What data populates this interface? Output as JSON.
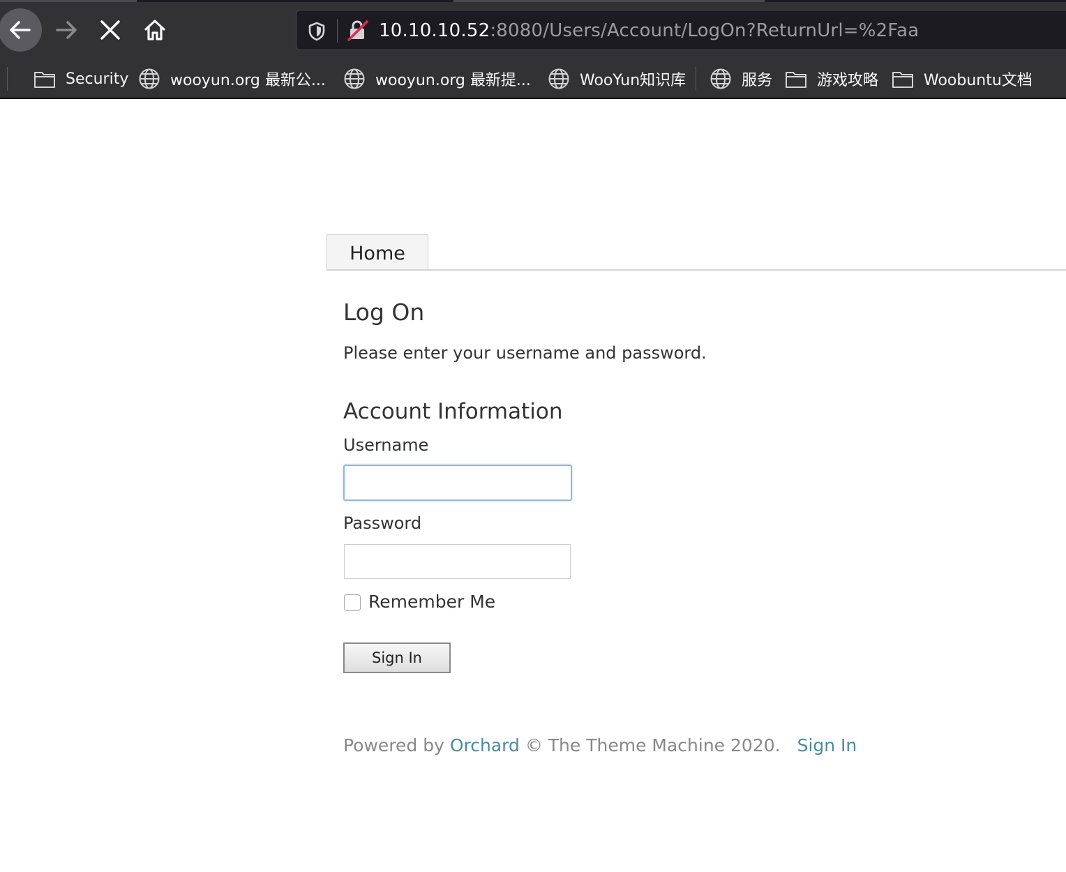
{
  "browser": {
    "url_host": "10.10.10.52",
    "url_rest": ":8080/Users/Account/LogOn?ReturnUrl=%2Faa",
    "bookmarks": [
      {
        "label": "Security",
        "icon": "folder-icon"
      },
      {
        "label": "wooyun.org 最新公...",
        "icon": "globe-icon"
      },
      {
        "label": "wooyun.org 最新提...",
        "icon": "globe-icon"
      },
      {
        "label": "WooYun知识库",
        "icon": "globe-icon"
      },
      {
        "label": "服务",
        "icon": "globe-icon"
      },
      {
        "label": "游戏攻略",
        "icon": "folder-icon"
      },
      {
        "label": "Woobuntu文档",
        "icon": "folder-icon"
      }
    ]
  },
  "nav": {
    "home_label": "Home"
  },
  "logon": {
    "title": "Log On",
    "instructions": "Please enter your username and password.",
    "legend": "Account Information",
    "username_label": "Username",
    "username_value": "",
    "password_label": "Password",
    "password_value": "",
    "remember_label": "Remember Me",
    "remember_checked": false,
    "submit_label": "Sign In"
  },
  "footer": {
    "powered_prefix": "Powered by ",
    "orchard_link": "Orchard",
    "copyright": " © The Theme Machine 2020.",
    "signin_link": "Sign In"
  },
  "colors": {
    "link": "#4c8aa3",
    "focus_ring": "#8fb8e4",
    "chrome": "#323234"
  }
}
